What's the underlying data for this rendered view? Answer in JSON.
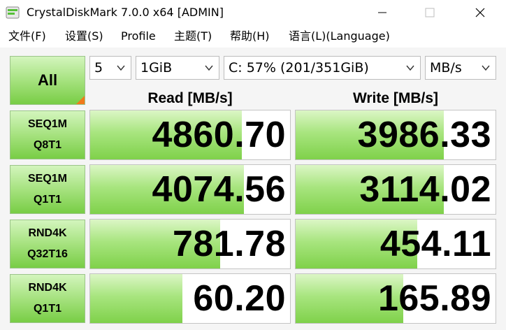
{
  "window": {
    "title": "CrystalDiskMark 7.0.0 x64 [ADMIN]"
  },
  "menu": [
    {
      "label": "文件(F)"
    },
    {
      "label": "设置(S)"
    },
    {
      "label": "Profile"
    },
    {
      "label": "主题(T)"
    },
    {
      "label": "帮助(H)"
    },
    {
      "label": "语言(L)(Language)"
    }
  ],
  "controls": {
    "all_label": "All",
    "count": "5",
    "size": "1GiB",
    "drive": "C: 57% (201/351GiB)",
    "unit": "MB/s"
  },
  "headers": {
    "read": "Read [MB/s]",
    "write": "Write [MB/s]"
  },
  "tests": [
    {
      "line1": "SEQ1M",
      "line2": "Q8T1",
      "read": "4860.70",
      "write": "3986.33",
      "read_fill": 0.76,
      "write_fill": 0.74
    },
    {
      "line1": "SEQ1M",
      "line2": "Q1T1",
      "read": "4074.56",
      "write": "3114.02",
      "read_fill": 0.77,
      "write_fill": 0.74
    },
    {
      "line1": "RND4K",
      "line2": "Q32T16",
      "read": "781.78",
      "write": "454.11",
      "read_fill": 0.65,
      "write_fill": 0.61
    },
    {
      "line1": "RND4K",
      "line2": "Q1T1",
      "read": "60.20",
      "write": "165.89",
      "read_fill": 0.46,
      "write_fill": 0.54
    }
  ],
  "colors": {
    "bar_green": "#7fd14a",
    "accent_orange": "#f07a1a"
  }
}
